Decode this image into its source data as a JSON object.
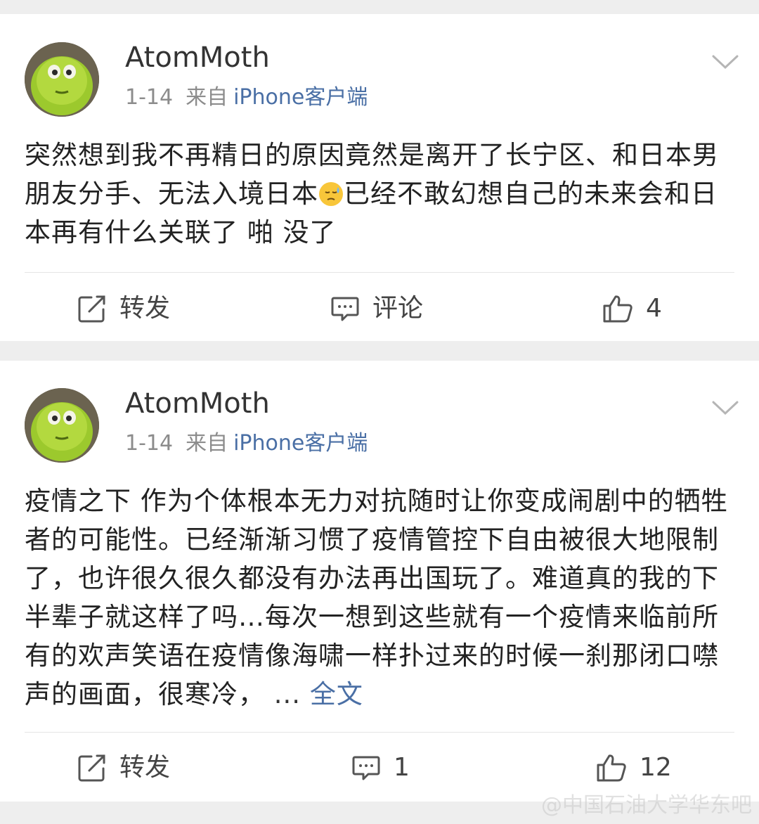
{
  "posts": [
    {
      "username": "AtomMoth",
      "date": "1-14",
      "from_label": "来自",
      "source": "iPhone客户端",
      "text_before_emoji": "突然想到我不再精日的原因竟然是离开了长宁区、和日本男朋友分手、无法入境日本",
      "emoji": "sweat-emoji",
      "text_after_emoji": "已经不敢幻想自己的未来会和日本再有什么关联了 啪 没了",
      "actions": {
        "repost": "转发",
        "comment": "评论",
        "like_count": "4"
      }
    },
    {
      "username": "AtomMoth",
      "date": "1-14",
      "from_label": "来自",
      "source": "iPhone客户端",
      "text": "疫情之下 作为个体根本无力对抗随时让你变成闹剧中的牺牲者的可能性。已经渐渐习惯了疫情管控下自由被很大地限制了，也许很久很久都没有办法再出国玩了。难道真的我的下半辈子就这样了吗…每次一想到这些就有一个疫情来临前所有的欢声笑语在疫情像海啸一样扑过来的时候一刹那闭口噤声的画面，很寒冷，",
      "ellipsis": "...",
      "full_text_link": "全文",
      "actions": {
        "repost": "转发",
        "comment_count": "1",
        "like_count": "12"
      }
    }
  ],
  "watermark": "@中国石油大学华东吧",
  "colors": {
    "link": "#4a6fa5",
    "meta": "#8c8c8c",
    "background": "#eeeeee"
  },
  "icons": [
    "avatar",
    "chevron-down-icon",
    "repost-icon",
    "comment-icon",
    "like-icon"
  ]
}
